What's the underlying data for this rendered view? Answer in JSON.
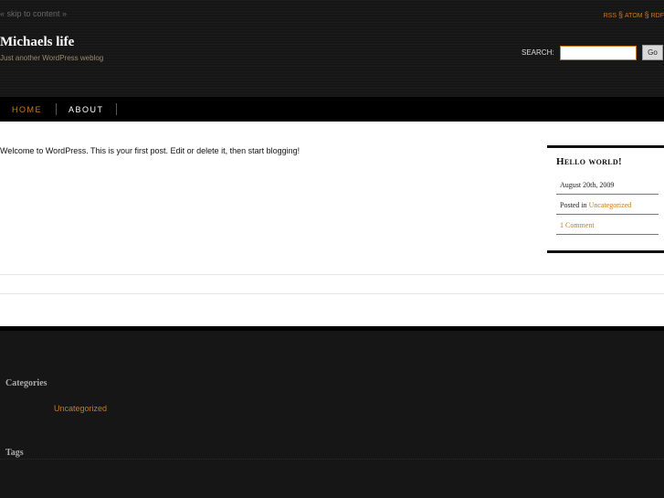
{
  "header": {
    "skip_link": "« skip to content »",
    "feeds": [
      "RSS",
      "ATOM",
      "RDF"
    ],
    "feed_separator": "§",
    "site_title": "Michaels life",
    "site_description": "Just another WordPress weblog",
    "search_label": "SEARCH:",
    "search_value": "",
    "search_button": "Go"
  },
  "nav": {
    "items": [
      {
        "label": "HOME",
        "active": true
      },
      {
        "label": "ABOUT",
        "active": false
      }
    ]
  },
  "post": {
    "content": "Welcome to WordPress. This is your first post. Edit or delete it, then start blogging!",
    "title": "Hello world!",
    "date": "August 20th, 2009",
    "posted_in_label": "Posted in",
    "category": "Uncategorized",
    "comments": "1 Comment"
  },
  "footer": {
    "categories_title": "Categories",
    "categories": [
      "Uncategorized"
    ],
    "tags_title": "Tags"
  },
  "colors": {
    "accent": "#c97a1a",
    "background": "#161616",
    "nav_background": "#000000",
    "content_background": "#ffffff"
  }
}
